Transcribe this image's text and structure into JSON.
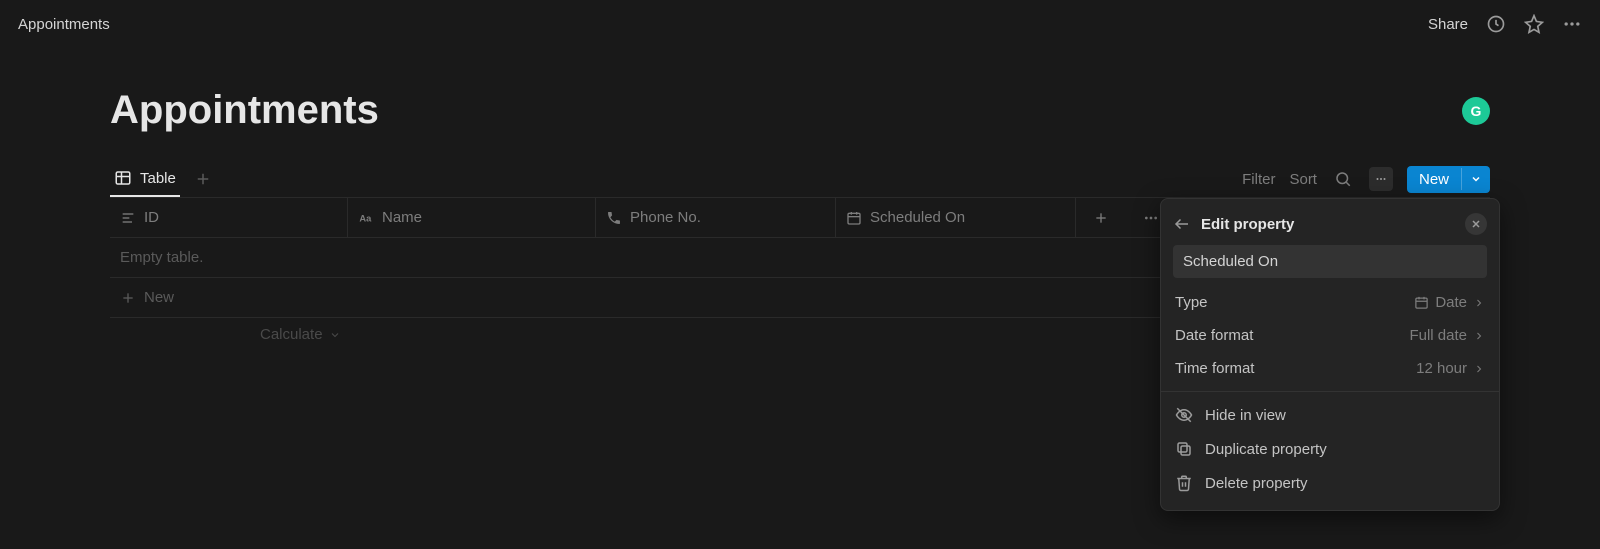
{
  "topbar": {
    "breadcrumb": "Appointments",
    "share": "Share"
  },
  "page": {
    "title": "Appointments",
    "avatar_initial": "G"
  },
  "views": {
    "active_tab": "Table"
  },
  "toolbar": {
    "filter": "Filter",
    "sort": "Sort",
    "new_button": "New"
  },
  "table": {
    "columns": [
      {
        "key": "id",
        "label": "ID",
        "icon": "text-align"
      },
      {
        "key": "name",
        "label": "Name",
        "icon": "text-aa"
      },
      {
        "key": "phone",
        "label": "Phone No.",
        "icon": "phone"
      },
      {
        "key": "scheduled",
        "label": "Scheduled On",
        "icon": "calendar"
      }
    ],
    "empty_text": "Empty table.",
    "new_row": "New",
    "calculate": "Calculate"
  },
  "popover": {
    "title": "Edit property",
    "name_value": "Scheduled On",
    "rows": {
      "type": {
        "label": "Type",
        "value": "Date"
      },
      "date_format": {
        "label": "Date format",
        "value": "Full date"
      },
      "time_format": {
        "label": "Time format",
        "value": "12 hour"
      }
    },
    "actions": {
      "hide": "Hide in view",
      "duplicate": "Duplicate property",
      "delete": "Delete property"
    }
  }
}
